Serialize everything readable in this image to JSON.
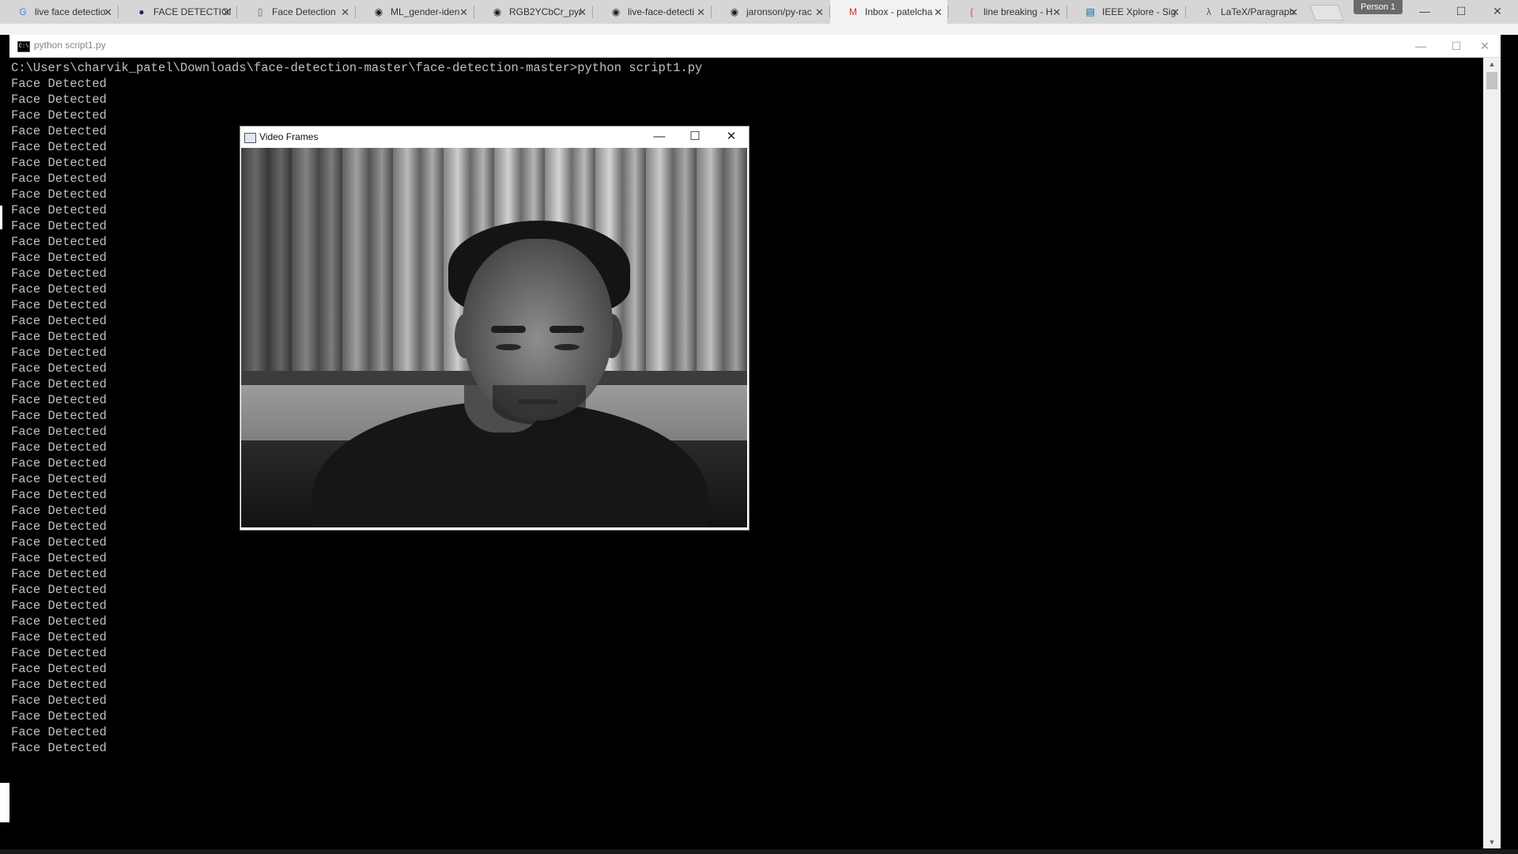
{
  "browser": {
    "tabs": [
      {
        "favicon": "google-icon",
        "title": "live face detectio"
      },
      {
        "favicon": "eclipse-icon",
        "title": "FACE DETECTION"
      },
      {
        "favicon": "doc-icon",
        "title": "Face Detection"
      },
      {
        "favicon": "github-icon",
        "title": "ML_gender-iden"
      },
      {
        "favicon": "github-icon",
        "title": "RGB2YCbCr_py/"
      },
      {
        "favicon": "github-icon",
        "title": "live-face-detecti"
      },
      {
        "favicon": "github-icon",
        "title": "jaronson/py-rac"
      },
      {
        "favicon": "gmail-icon",
        "title": "Inbox - patelcha"
      },
      {
        "favicon": "stackoverflow-icon",
        "title": "line breaking - H"
      },
      {
        "favicon": "ieee-icon",
        "title": "IEEE Xplore - Sig"
      },
      {
        "favicon": "latex-icon",
        "title": "LaTeX/Paragraph"
      }
    ],
    "active_tab_index": 7,
    "profile_label": "Person 1"
  },
  "console": {
    "title": "python  script1.py",
    "command": "C:\\Users\\charvik_patel\\Downloads\\face-detection-master\\face-detection-master>python script1.py",
    "output_line": "Face Detected",
    "output_count": 43
  },
  "video_window": {
    "title": "Video Frames"
  },
  "glyphs": {
    "minimize": "—",
    "maximize": "☐",
    "close": "✕",
    "scroll_up": "▲",
    "scroll_down": "▼"
  }
}
